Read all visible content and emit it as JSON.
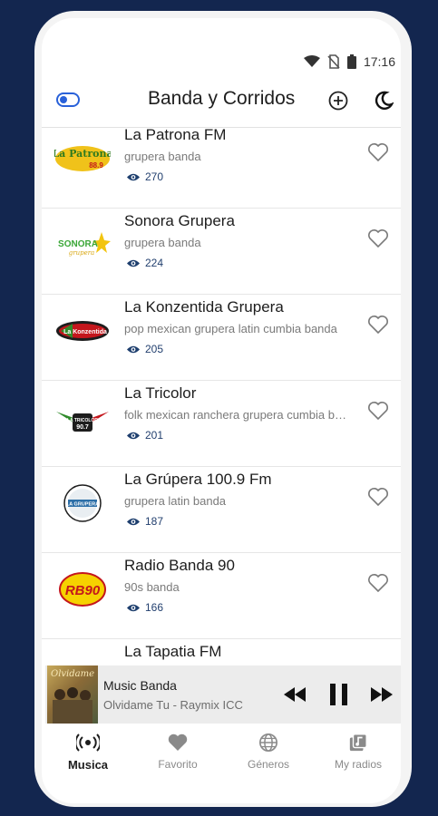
{
  "status_bar": {
    "time": "17:16"
  },
  "app_bar": {
    "title": "Banda y Corridos"
  },
  "stations": [
    {
      "name": "La Patrona FM",
      "tags": "grupera banda",
      "views": "270"
    },
    {
      "name": "Sonora Grupera",
      "tags": "grupera banda",
      "views": "224"
    },
    {
      "name": "La Konzentida Grupera",
      "tags": "pop mexican grupera latin cumbia banda",
      "views": "205"
    },
    {
      "name": "La Tricolor",
      "tags": "folk mexican ranchera grupera cumbia banda",
      "views": "201"
    },
    {
      "name": "La Grúpera 100.9 Fm",
      "tags": "grupera latin banda",
      "views": "187"
    },
    {
      "name": "Radio Banda 90",
      "tags": "90s banda",
      "views": "166"
    },
    {
      "name": "La Tapatia FM",
      "tags": "",
      "views": ""
    }
  ],
  "logos": {
    "patrona_word": "La Patrona",
    "patrona_freq": "88.9",
    "sonora_word": "SONORA",
    "sonora_sub": "grupera",
    "konzentida_word": "La Konzentida",
    "tricolor_word": "LA TRICOLOR",
    "tricolor_freq": "90.7",
    "grupera_word": "LA GRUPERA",
    "rb90_word": "RB90"
  },
  "player": {
    "title": "Music Banda",
    "subtitle": "Olvidame Tu - Raymix ICC",
    "cover_text": "Olvidame"
  },
  "bottom_nav": [
    {
      "label": "Musica",
      "icon": "radio-waves-icon",
      "active": true
    },
    {
      "label": "Favorito",
      "icon": "heart-icon",
      "active": false
    },
    {
      "label": "Géneros",
      "icon": "globe-icon",
      "active": false
    },
    {
      "label": "My radios",
      "icon": "music-library-icon",
      "active": false
    }
  ],
  "colors": {
    "background": "#13264f",
    "accent": "#2961d9",
    "view_count": "#23406f"
  }
}
